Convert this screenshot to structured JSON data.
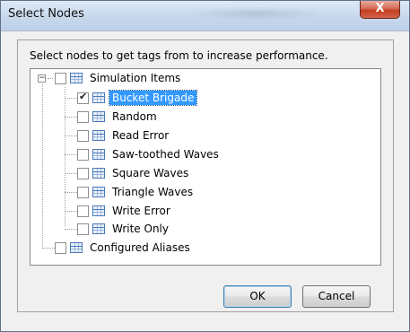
{
  "dialog": {
    "title": "Select Nodes",
    "close_glyph": "X",
    "instruction": "Select nodes to get tags from to increase performance.",
    "ok_label": "OK",
    "cancel_label": "Cancel"
  },
  "tree": {
    "root": {
      "label": "Simulation Items",
      "expanded": true,
      "checked": false,
      "expander_glyph": "−"
    },
    "children": [
      {
        "label": "Bucket Brigade",
        "checked": true,
        "selected": true
      },
      {
        "label": "Random",
        "checked": false
      },
      {
        "label": "Read Error",
        "checked": false
      },
      {
        "label": "Saw-toothed Waves",
        "checked": false
      },
      {
        "label": "Square Waves",
        "checked": false
      },
      {
        "label": "Triangle Waves",
        "checked": false
      },
      {
        "label": "Write Error",
        "checked": false
      },
      {
        "label": "Write Only",
        "checked": false
      }
    ],
    "sibling": {
      "label": "Configured Aliases",
      "checked": false
    }
  },
  "icons": {
    "node_icon": "table-icon",
    "checkbox_checked": "checkmark-icon",
    "close": "close-icon"
  },
  "colors": {
    "selection_bg": "#3399ff",
    "close_button": "#c43e22",
    "title_bar": "#c7d8ec"
  }
}
